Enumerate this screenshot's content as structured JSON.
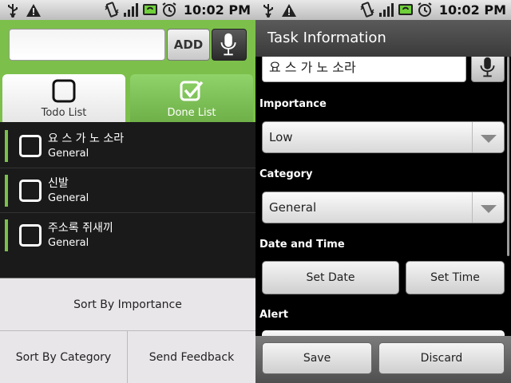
{
  "status_bar": {
    "time": "10:02 PM"
  },
  "left_screen": {
    "entry": {
      "value": "",
      "add_label": "ADD"
    },
    "tabs": [
      {
        "label": "Todo List",
        "selected": true
      },
      {
        "label": "Done List",
        "selected": false
      }
    ],
    "tasks": [
      {
        "title": "요 스 가 노 소라",
        "category": "General",
        "checked": false
      },
      {
        "title": "신발",
        "category": "General",
        "checked": false
      },
      {
        "title": "주소록 쥐새끼",
        "category": "General",
        "checked": false
      }
    ],
    "menu": {
      "sort_importance": "Sort By Importance",
      "sort_category": "Sort By Category",
      "send_feedback": "Send Feedback"
    }
  },
  "right_screen": {
    "title": "Task Information",
    "name_value": "요 스 가 노 소라",
    "importance_label": "Importance",
    "importance_value": "Low",
    "category_label": "Category",
    "category_value": "General",
    "datetime_label": "Date and Time",
    "set_date": "Set Date",
    "set_time": "Set Time",
    "alert_label": "Alert",
    "save": "Save",
    "discard": "Discard"
  },
  "colors": {
    "accent_green": "#7cc04b"
  },
  "icons": [
    "usb-icon",
    "warning-icon",
    "vibrate-icon",
    "signal-icon",
    "battery-icon",
    "alarm-icon",
    "microphone-icon",
    "checkbox-icon",
    "dropdown-arrow-icon"
  ]
}
